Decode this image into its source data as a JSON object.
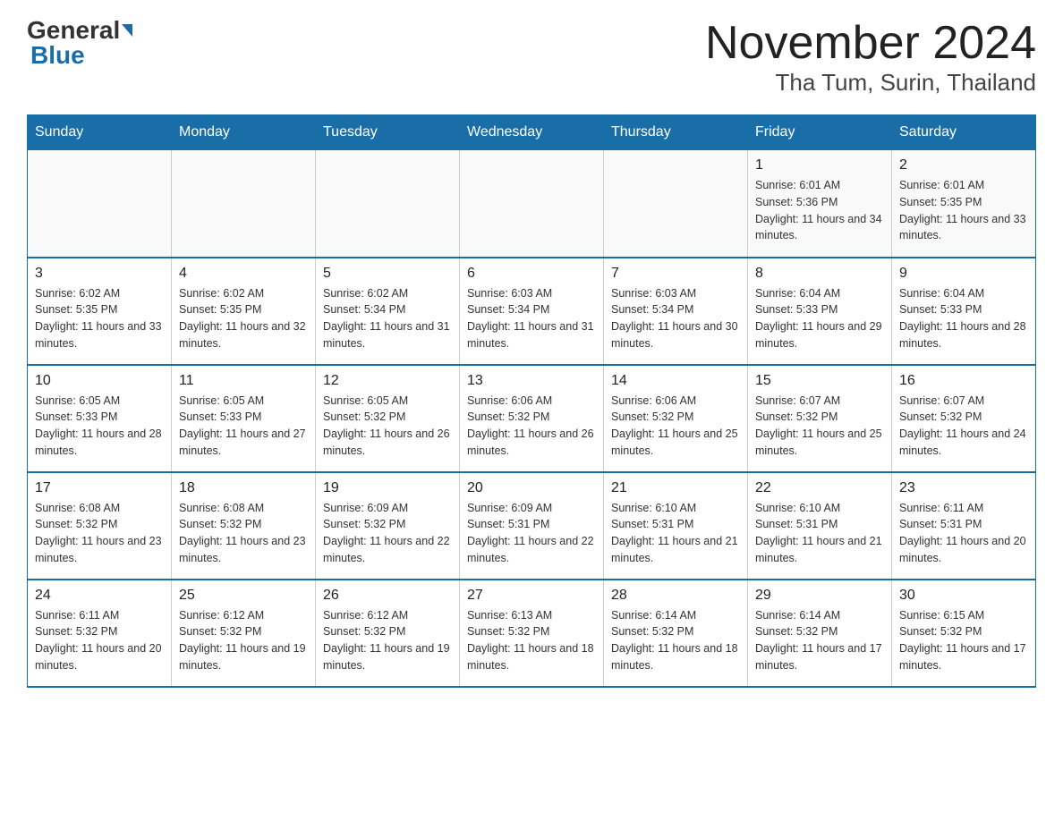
{
  "logo": {
    "general": "General",
    "blue": "Blue"
  },
  "title": {
    "month": "November 2024",
    "location": "Tha Tum, Surin, Thailand"
  },
  "weekdays": [
    "Sunday",
    "Monday",
    "Tuesday",
    "Wednesday",
    "Thursday",
    "Friday",
    "Saturday"
  ],
  "weeks": [
    [
      {
        "day": "",
        "info": ""
      },
      {
        "day": "",
        "info": ""
      },
      {
        "day": "",
        "info": ""
      },
      {
        "day": "",
        "info": ""
      },
      {
        "day": "",
        "info": ""
      },
      {
        "day": "1",
        "info": "Sunrise: 6:01 AM\nSunset: 5:36 PM\nDaylight: 11 hours and 34 minutes."
      },
      {
        "day": "2",
        "info": "Sunrise: 6:01 AM\nSunset: 5:35 PM\nDaylight: 11 hours and 33 minutes."
      }
    ],
    [
      {
        "day": "3",
        "info": "Sunrise: 6:02 AM\nSunset: 5:35 PM\nDaylight: 11 hours and 33 minutes."
      },
      {
        "day": "4",
        "info": "Sunrise: 6:02 AM\nSunset: 5:35 PM\nDaylight: 11 hours and 32 minutes."
      },
      {
        "day": "5",
        "info": "Sunrise: 6:02 AM\nSunset: 5:34 PM\nDaylight: 11 hours and 31 minutes."
      },
      {
        "day": "6",
        "info": "Sunrise: 6:03 AM\nSunset: 5:34 PM\nDaylight: 11 hours and 31 minutes."
      },
      {
        "day": "7",
        "info": "Sunrise: 6:03 AM\nSunset: 5:34 PM\nDaylight: 11 hours and 30 minutes."
      },
      {
        "day": "8",
        "info": "Sunrise: 6:04 AM\nSunset: 5:33 PM\nDaylight: 11 hours and 29 minutes."
      },
      {
        "day": "9",
        "info": "Sunrise: 6:04 AM\nSunset: 5:33 PM\nDaylight: 11 hours and 28 minutes."
      }
    ],
    [
      {
        "day": "10",
        "info": "Sunrise: 6:05 AM\nSunset: 5:33 PM\nDaylight: 11 hours and 28 minutes."
      },
      {
        "day": "11",
        "info": "Sunrise: 6:05 AM\nSunset: 5:33 PM\nDaylight: 11 hours and 27 minutes."
      },
      {
        "day": "12",
        "info": "Sunrise: 6:05 AM\nSunset: 5:32 PM\nDaylight: 11 hours and 26 minutes."
      },
      {
        "day": "13",
        "info": "Sunrise: 6:06 AM\nSunset: 5:32 PM\nDaylight: 11 hours and 26 minutes."
      },
      {
        "day": "14",
        "info": "Sunrise: 6:06 AM\nSunset: 5:32 PM\nDaylight: 11 hours and 25 minutes."
      },
      {
        "day": "15",
        "info": "Sunrise: 6:07 AM\nSunset: 5:32 PM\nDaylight: 11 hours and 25 minutes."
      },
      {
        "day": "16",
        "info": "Sunrise: 6:07 AM\nSunset: 5:32 PM\nDaylight: 11 hours and 24 minutes."
      }
    ],
    [
      {
        "day": "17",
        "info": "Sunrise: 6:08 AM\nSunset: 5:32 PM\nDaylight: 11 hours and 23 minutes."
      },
      {
        "day": "18",
        "info": "Sunrise: 6:08 AM\nSunset: 5:32 PM\nDaylight: 11 hours and 23 minutes."
      },
      {
        "day": "19",
        "info": "Sunrise: 6:09 AM\nSunset: 5:32 PM\nDaylight: 11 hours and 22 minutes."
      },
      {
        "day": "20",
        "info": "Sunrise: 6:09 AM\nSunset: 5:31 PM\nDaylight: 11 hours and 22 minutes."
      },
      {
        "day": "21",
        "info": "Sunrise: 6:10 AM\nSunset: 5:31 PM\nDaylight: 11 hours and 21 minutes."
      },
      {
        "day": "22",
        "info": "Sunrise: 6:10 AM\nSunset: 5:31 PM\nDaylight: 11 hours and 21 minutes."
      },
      {
        "day": "23",
        "info": "Sunrise: 6:11 AM\nSunset: 5:31 PM\nDaylight: 11 hours and 20 minutes."
      }
    ],
    [
      {
        "day": "24",
        "info": "Sunrise: 6:11 AM\nSunset: 5:32 PM\nDaylight: 11 hours and 20 minutes."
      },
      {
        "day": "25",
        "info": "Sunrise: 6:12 AM\nSunset: 5:32 PM\nDaylight: 11 hours and 19 minutes."
      },
      {
        "day": "26",
        "info": "Sunrise: 6:12 AM\nSunset: 5:32 PM\nDaylight: 11 hours and 19 minutes."
      },
      {
        "day": "27",
        "info": "Sunrise: 6:13 AM\nSunset: 5:32 PM\nDaylight: 11 hours and 18 minutes."
      },
      {
        "day": "28",
        "info": "Sunrise: 6:14 AM\nSunset: 5:32 PM\nDaylight: 11 hours and 18 minutes."
      },
      {
        "day": "29",
        "info": "Sunrise: 6:14 AM\nSunset: 5:32 PM\nDaylight: 11 hours and 17 minutes."
      },
      {
        "day": "30",
        "info": "Sunrise: 6:15 AM\nSunset: 5:32 PM\nDaylight: 11 hours and 17 minutes."
      }
    ]
  ]
}
